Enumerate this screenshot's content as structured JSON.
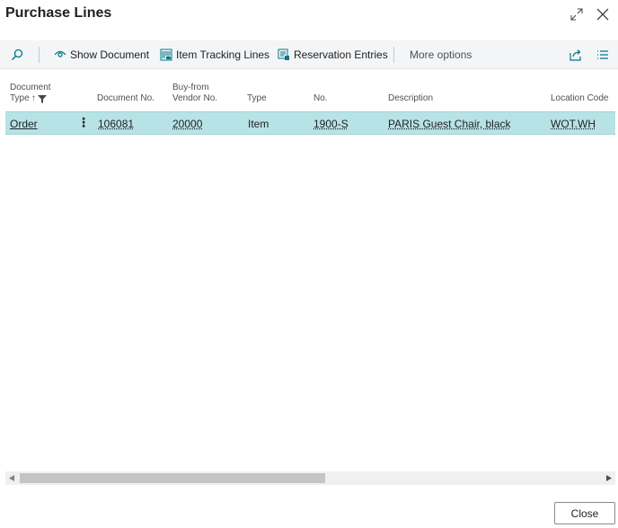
{
  "window": {
    "title": "Purchase Lines"
  },
  "toolbar": {
    "show_document": "Show Document",
    "item_tracking_lines": "Item Tracking Lines",
    "reservation_entries": "Reservation Entries",
    "more_options": "More options"
  },
  "table": {
    "headers": {
      "document_type_1": "Document",
      "document_type_2": "Type",
      "document_no": "Document No.",
      "vendor_1": "Buy-from",
      "vendor_2": "Vendor No.",
      "type": "Type",
      "no": "No.",
      "description": "Description",
      "location_code": "Location Code"
    },
    "rows": [
      {
        "document_type": "Order",
        "document_no": "106081",
        "vendor_no": "20000",
        "type": "Item",
        "no": "1900-S",
        "description": "PARIS Guest Chair, black",
        "location_code": "WOT.WH"
      }
    ]
  },
  "footer": {
    "close_label": "Close"
  },
  "colors": {
    "selected_row": "#b7e3e7",
    "accent": "#00788a"
  }
}
